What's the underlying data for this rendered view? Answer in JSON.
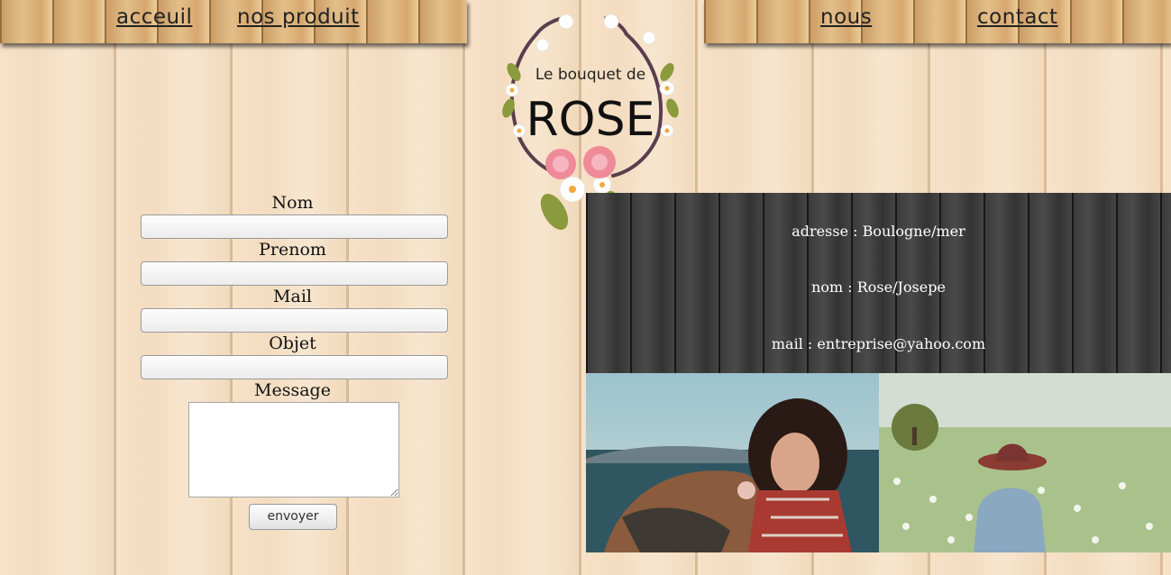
{
  "nav": {
    "left": [
      {
        "label": "acceuil"
      },
      {
        "label": "nos produit"
      }
    ],
    "right": [
      {
        "label": "nous"
      },
      {
        "label": "contact"
      }
    ]
  },
  "logo": {
    "line1": "Le bouquet de",
    "line2": "ROSE"
  },
  "form": {
    "fields": [
      {
        "label": "Nom",
        "value": ""
      },
      {
        "label": "Prenom",
        "value": ""
      },
      {
        "label": "Mail",
        "value": ""
      },
      {
        "label": "Objet",
        "value": ""
      }
    ],
    "message_label": "Message",
    "submit_label": "envoyer"
  },
  "info": {
    "address": "adresse : Boulogne/mer",
    "name": "nom : Rose/Josepe",
    "mail": "mail : entreprise@yahoo.com"
  },
  "colors": {
    "wood_light": "#f6e2c8",
    "wood_dark": "#3a3a3a",
    "nav_wood": "#e3bf8a"
  }
}
